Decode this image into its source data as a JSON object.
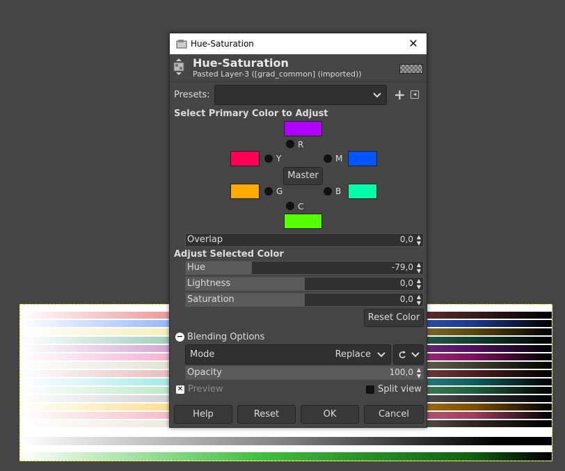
{
  "dialog": {
    "title": "Hue-Saturation",
    "close_glyph": "✕",
    "header_title": "Hue-Saturation",
    "header_subtitle": "Pasted Layer-3 ([grad_common] (imported))"
  },
  "presets": {
    "label": "Presets:",
    "value": "",
    "add_glyph": "+",
    "menu_glyph": "◂"
  },
  "primary": {
    "heading": "Select Primary Color to Adjust",
    "master_label": "Master",
    "channels": [
      {
        "label": "R",
        "color": "#b000ff"
      },
      {
        "label": "Y",
        "color": "#ff0055"
      },
      {
        "label": "M",
        "color": "#0055ff"
      },
      {
        "label": "G",
        "color": "#ffaa00"
      },
      {
        "label": "B",
        "color": "#00ffaa"
      },
      {
        "label": "C",
        "color": "#55ff00"
      }
    ]
  },
  "overlap": {
    "label": "Overlap",
    "value": "0,0",
    "fraction": 0
  },
  "adjust": {
    "heading": "Adjust Selected Color",
    "hue": {
      "label": "Hue",
      "value": "-79,0",
      "fraction": 0.28
    },
    "lightness": {
      "label": "Lightness",
      "value": "0,0",
      "fraction": 0.5
    },
    "saturation": {
      "label": "Saturation",
      "value": "0,0",
      "fraction": 0.5
    },
    "reset_color_label": "Reset Color"
  },
  "blending": {
    "toggle_glyph": "−",
    "label": "Blending Options",
    "mode_label": "Mode",
    "mode_value": "Replace",
    "opacity": {
      "label": "Opacity",
      "value": "100,0",
      "fraction": 1.0
    }
  },
  "preview": {
    "label": "Preview",
    "checked": true,
    "check_glyph": "✕"
  },
  "split_view": {
    "label": "Split view",
    "checked": false
  },
  "buttons": {
    "help": "Help",
    "reset": "Reset",
    "ok": "OK",
    "cancel": "Cancel"
  },
  "colors": {
    "background": "#454545",
    "selection": "#e6e600"
  }
}
